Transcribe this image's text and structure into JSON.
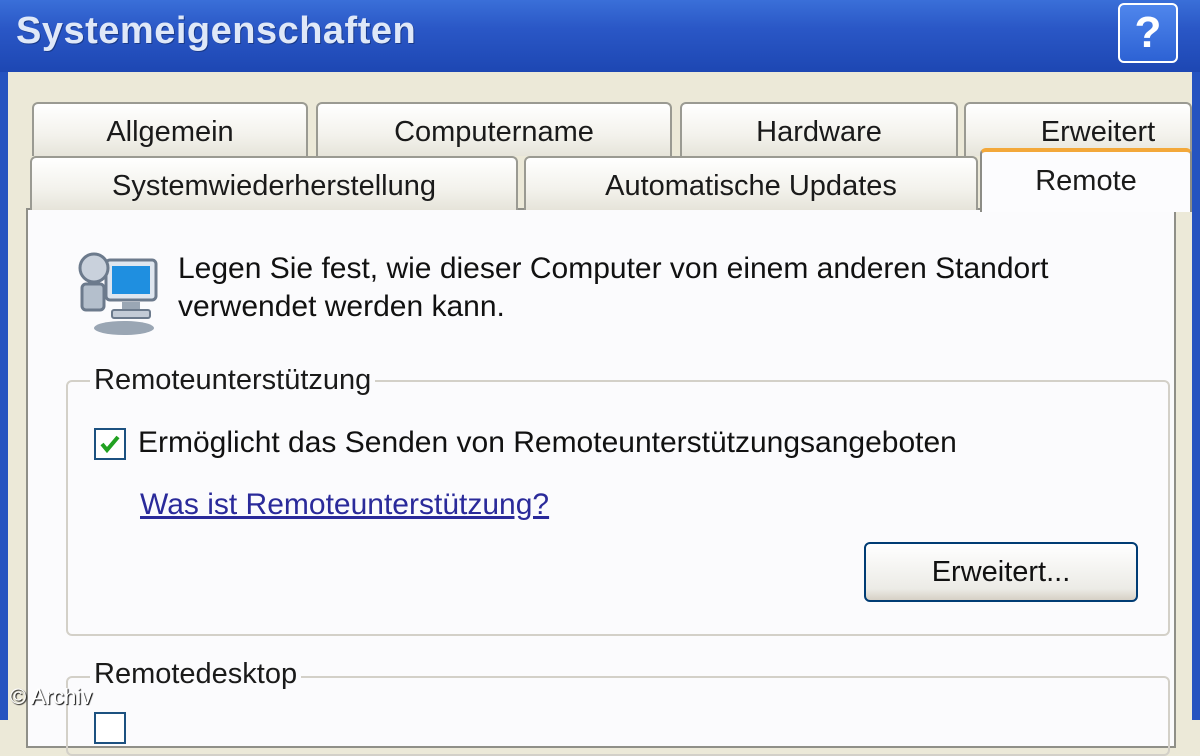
{
  "window": {
    "title": "Systemeigenschaften",
    "help_label": "?"
  },
  "tabs_row_back": [
    {
      "label": "Allgemein"
    },
    {
      "label": "Computername"
    },
    {
      "label": "Hardware"
    },
    {
      "label": "Erweitert"
    }
  ],
  "tabs_row_front": [
    {
      "label": "Systemwiederherstellung"
    },
    {
      "label": "Automatische Updates"
    },
    {
      "label": "Remote",
      "active": true
    }
  ],
  "intro": {
    "line1": "Legen Sie fest, wie dieser Computer von einem anderen Standort",
    "line2": "verwendet werden kann.",
    "icon": "remote-computer-icon"
  },
  "remote_assistance": {
    "legend": "Remoteunterstützung",
    "checkbox_label": "Ermöglicht das Senden von Remoteunterstützungsangeboten",
    "checked": true,
    "help_link": "Was ist Remoteunterstützung?",
    "advanced_button": "Erweitert..."
  },
  "remote_desktop": {
    "legend": "Remotedesktop"
  },
  "watermark": "© Archiv",
  "colors": {
    "titlebar": "#2a57c6",
    "dialog_bg": "#ece9d8",
    "panel_bg": "#fbfbfd",
    "active_tab_accent": "#f3a83a",
    "checkmark": "#21a121",
    "link": "#2a2a9a"
  }
}
